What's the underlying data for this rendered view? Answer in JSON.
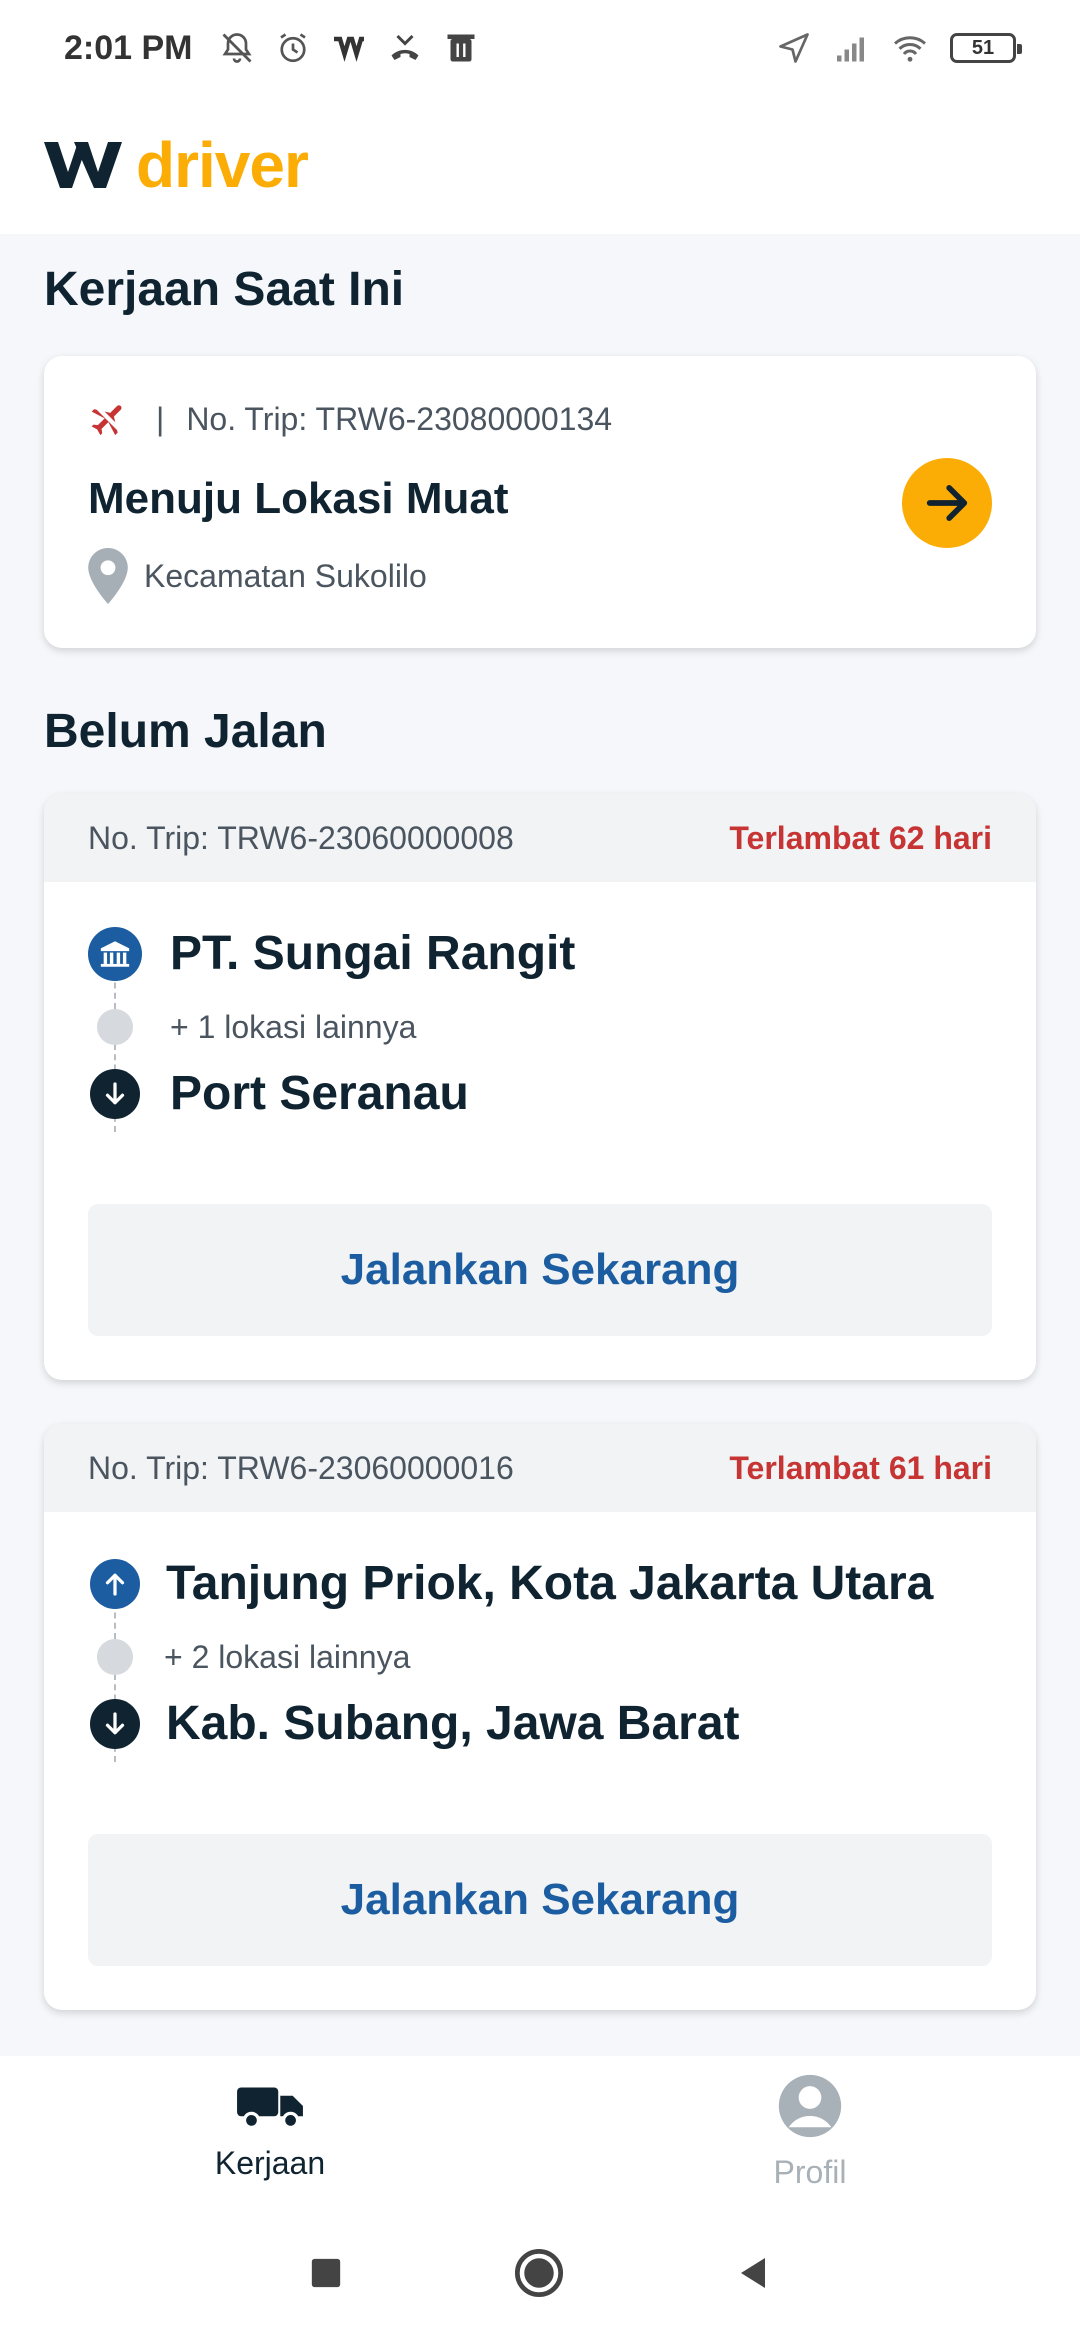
{
  "status_bar": {
    "time": "2:01 PM",
    "battery": "51",
    "left_icons": [
      "bell-muted-icon",
      "alarm-icon",
      "app-w-icon",
      "missed-call-icon",
      "trash-icon"
    ],
    "right_icons": [
      "location-icon",
      "signal-icon",
      "wifi-icon",
      "battery-icon"
    ]
  },
  "header": {
    "logo_text": "driver",
    "logo_colors": {
      "mark": "#0f2330",
      "text": "#fbac05"
    }
  },
  "current": {
    "section_title": "Kerjaan Saat Ini",
    "trip_no": "No. Trip: TRW6-23080000134",
    "separator": "|",
    "status": "Menuju Lokasi Muat",
    "location": "Kecamatan Sukolilo",
    "icons": [
      "plane-off-icon",
      "location-pin-icon",
      "arrow-right-icon"
    ]
  },
  "pending": {
    "section_title": "Belum Jalan",
    "trips": [
      {
        "trip_no": "No. Trip: TRW6-23060000008",
        "late": "Terlambat 62 hari",
        "origin": "PT. Sungai Rangit",
        "origin_icon": "warehouse-icon",
        "more": "+ 1 lokasi lainnya",
        "destination": "Port Seranau",
        "button": "Jalankan Sekarang"
      },
      {
        "trip_no": "No. Trip: TRW6-23060000016",
        "late": "Terlambat 61 hari",
        "origin": "Tanjung Priok, Kota Jakarta Utara",
        "origin_icon": "arrow-up-icon",
        "more": "+ 2 lokasi lainnya",
        "destination": "Kab. Subang, Jawa Barat",
        "button": "Jalankan Sekarang"
      }
    ]
  },
  "bottom_nav": {
    "items": [
      {
        "label": "Kerjaan",
        "icon": "truck-icon",
        "active": true
      },
      {
        "label": "Profil",
        "icon": "profile-icon",
        "active": false
      }
    ]
  },
  "colors": {
    "accent": "#fbac05",
    "late": "#c73434",
    "button_text": "#1c5da1",
    "primary_blue": "#1c5da1",
    "dark": "#0f2330"
  }
}
